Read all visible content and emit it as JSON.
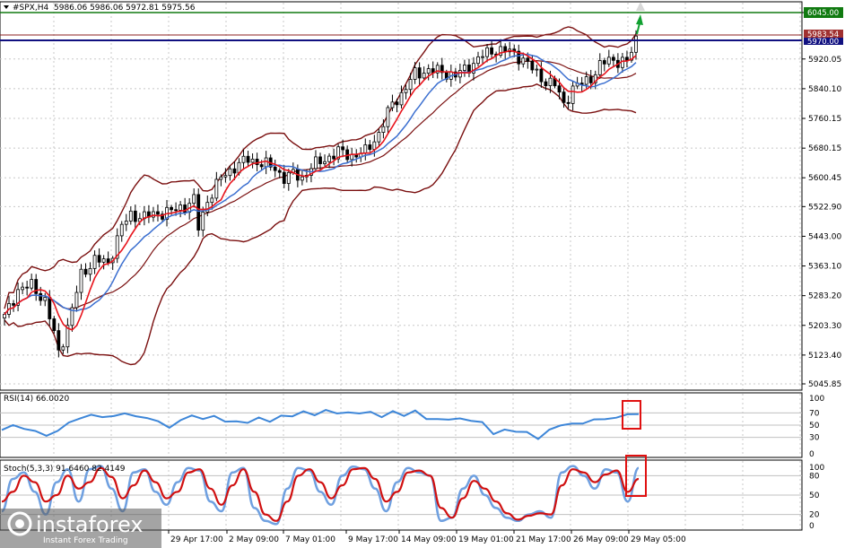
{
  "header": {
    "symbol": "#SPX,H4",
    "ohlc": "5986.06 5986.06 5972.81 5975.56"
  },
  "levels": {
    "resistance": "6045.00",
    "price": "5983.54",
    "support": "5970.00"
  },
  "rsi_label": "RSI(14) 66.0020",
  "stoch_label": "Stoch(5,3,3) 91.6460 82.4149",
  "watermark": {
    "brand": "instaforex",
    "tagline": "Instant Forex Trading"
  },
  "colors": {
    "candle": "#000000",
    "bollinger": "#7a0f0f",
    "ma_fast": "#e8141c",
    "ma_slow": "#3b6fd0",
    "rsi": "#3d86d8",
    "stoch_main": "#6fa0e0",
    "stoch_signal": "#d01010",
    "level_green": "#107a10",
    "level_navy": "#101080",
    "highlight": "#e01010",
    "arrow": "#10a030"
  },
  "chart_data": [
    {
      "type": "candlestick",
      "name": "price",
      "y_ticks": [
        "6045.00",
        "5920.05",
        "5840.10",
        "5760.15",
        "5680.15",
        "5600.45",
        "5522.90",
        "5443.00",
        "5363.10",
        "5283.20",
        "5203.30",
        "5123.40",
        "5045.85"
      ],
      "x_labels": [
        "29 Apr 17:00",
        "2 May 09:00",
        "7 May 01:00",
        "9 May 17:00",
        "14 May 09:00",
        "19 May 01:00",
        "21 May 17:00",
        "26 May 09:00",
        "29 May 05:00"
      ],
      "ylim": [
        5040,
        6060
      ],
      "close_path": [
        [
          0,
          5225
        ],
        [
          3,
          5300
        ],
        [
          6,
          5310
        ],
        [
          9,
          5270
        ],
        [
          11,
          5180
        ],
        [
          12,
          5130
        ],
        [
          14,
          5200
        ],
        [
          17,
          5340
        ],
        [
          20,
          5380
        ],
        [
          23,
          5370
        ],
        [
          26,
          5470
        ],
        [
          28,
          5500
        ],
        [
          31,
          5495
        ],
        [
          34,
          5505
        ],
        [
          37,
          5510
        ],
        [
          40,
          5525
        ],
        [
          42,
          5540
        ],
        [
          43,
          5465
        ],
        [
          45,
          5540
        ],
        [
          48,
          5600
        ],
        [
          51,
          5630
        ],
        [
          54,
          5650
        ],
        [
          57,
          5640
        ],
        [
          60,
          5625
        ],
        [
          62,
          5600
        ],
        [
          64,
          5610
        ],
        [
          66,
          5600
        ],
        [
          68,
          5630
        ],
        [
          71,
          5650
        ],
        [
          74,
          5670
        ],
        [
          77,
          5660
        ],
        [
          80,
          5670
        ],
        [
          83,
          5720
        ],
        [
          86,
          5800
        ],
        [
          88,
          5825
        ],
        [
          91,
          5880
        ],
        [
          94,
          5890
        ],
        [
          97,
          5885
        ],
        [
          100,
          5875
        ],
        [
          103,
          5900
        ],
        [
          106,
          5930
        ],
        [
          109,
          5945
        ],
        [
          112,
          5940
        ],
        [
          115,
          5920
        ],
        [
          118,
          5880
        ],
        [
          120,
          5860
        ],
        [
          122,
          5850
        ],
        [
          124,
          5800
        ],
        [
          126,
          5840
        ],
        [
          128,
          5855
        ],
        [
          130,
          5870
        ],
        [
          132,
          5900
        ],
        [
          134,
          5920
        ],
        [
          136,
          5915
        ],
        [
          138,
          5910
        ],
        [
          140,
          5975
        ]
      ]
    },
    {
      "type": "line",
      "name": "RSI(14)",
      "value": 66.002,
      "ylim": [
        0,
        100
      ],
      "y_ticks": [
        "100",
        "70",
        "50",
        "30",
        "0"
      ],
      "values": [
        42,
        50,
        44,
        40,
        33,
        40,
        55,
        60,
        68,
        62,
        66,
        68,
        66,
        60,
        58,
        44,
        60,
        64,
        62,
        63,
        58,
        54,
        56,
        60,
        58,
        63,
        67,
        70,
        69,
        72,
        72,
        68,
        72,
        69,
        66,
        70,
        68,
        71,
        63,
        57,
        62,
        58,
        60,
        52,
        38,
        40,
        42,
        36,
        30,
        40,
        52,
        50,
        55,
        57,
        62,
        60,
        70,
        66
      ]
    },
    {
      "type": "line",
      "name": "Stoch(5,3,3)",
      "main": 91.646,
      "signal": 82.4149,
      "ylim": [
        0,
        100
      ],
      "y_ticks": [
        "100",
        "80",
        "50",
        "20",
        "0"
      ],
      "main_values": [
        25,
        75,
        85,
        55,
        20,
        70,
        90,
        40,
        90,
        95,
        60,
        25,
        85,
        90,
        55,
        35,
        70,
        92,
        88,
        40,
        25,
        85,
        92,
        30,
        10,
        5,
        60,
        92,
        88,
        55,
        35,
        80,
        94,
        90,
        60,
        25,
        70,
        92,
        85,
        80,
        10,
        15,
        60,
        80,
        50,
        30,
        15,
        10,
        20,
        25,
        15,
        85,
        95,
        80,
        60,
        90,
        85,
        40,
        92
      ],
      "signal_values": [
        40,
        55,
        80,
        70,
        40,
        50,
        80,
        60,
        70,
        92,
        78,
        45,
        65,
        88,
        70,
        45,
        55,
        85,
        90,
        60,
        35,
        65,
        90,
        55,
        20,
        10,
        40,
        80,
        90,
        70,
        45,
        65,
        90,
        92,
        75,
        40,
        55,
        85,
        88,
        80,
        30,
        15,
        45,
        72,
        60,
        40,
        22,
        12,
        18,
        22,
        20,
        65,
        90,
        85,
        70,
        82,
        88,
        55,
        75
      ]
    }
  ]
}
